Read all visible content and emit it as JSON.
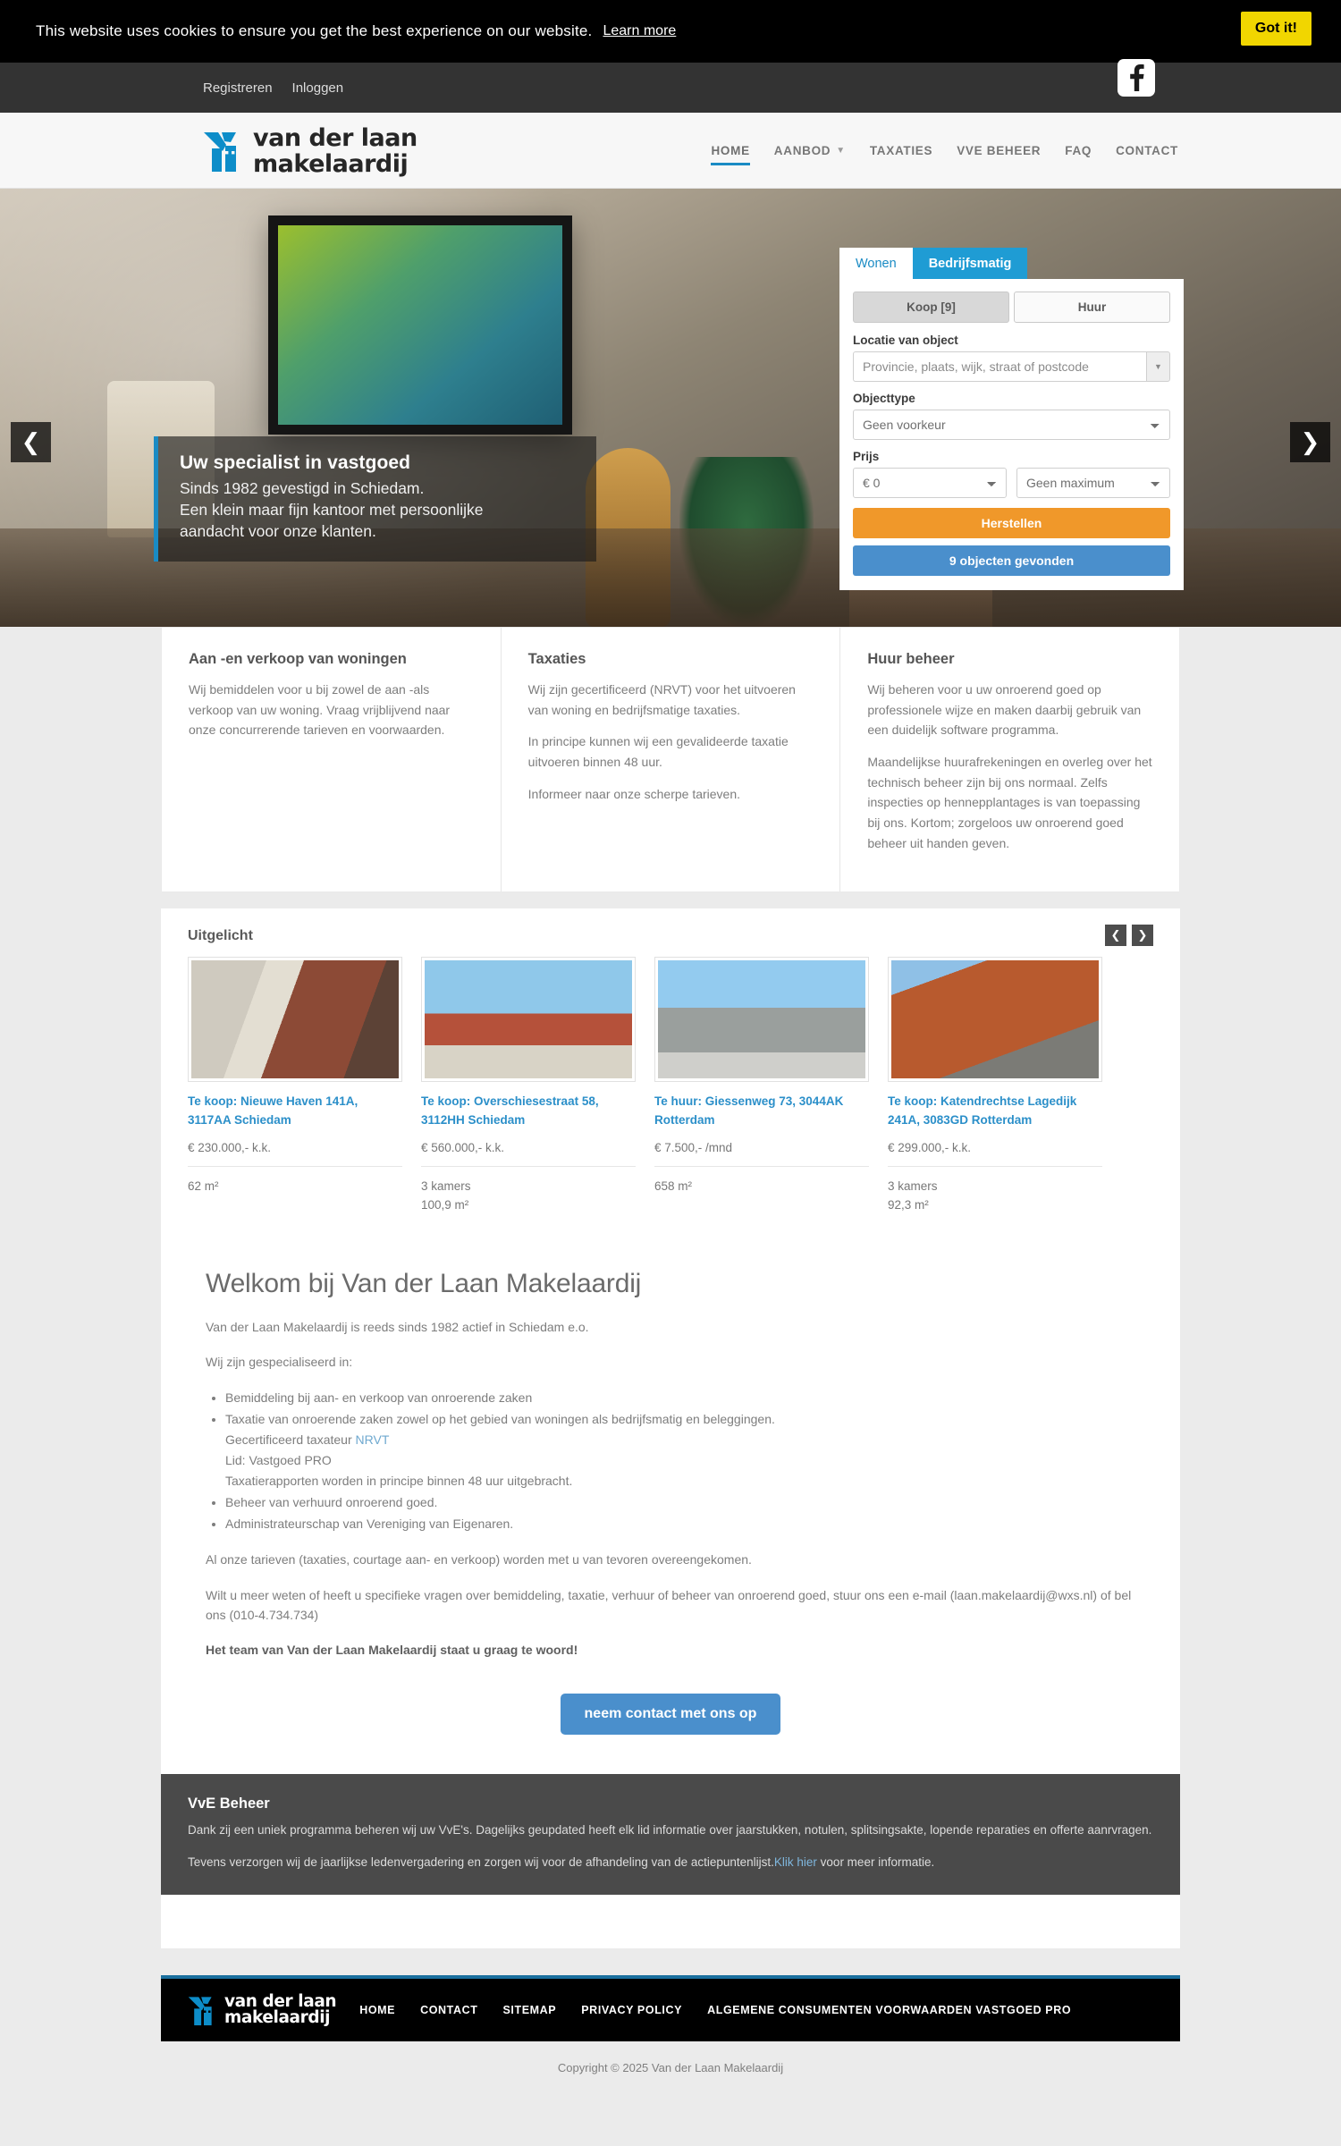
{
  "cookie": {
    "message": "This website uses cookies to ensure you get the best experience on our website.",
    "learn_more": "Learn more",
    "accept": "Got it!"
  },
  "topbar": {
    "register": "Registreren",
    "login": "Inloggen",
    "facebook_icon": "facebook-icon"
  },
  "brand": {
    "line1": "van der laan",
    "line2": "makelaardij",
    "mark_icon": "house-logo-icon"
  },
  "nav": {
    "items": [
      {
        "label": "HOME",
        "active": true,
        "caret": false
      },
      {
        "label": "AANBOD",
        "active": false,
        "caret": true
      },
      {
        "label": "TAXATIES",
        "active": false,
        "caret": false
      },
      {
        "label": "VVE BEHEER",
        "active": false,
        "caret": false
      },
      {
        "label": "FAQ",
        "active": false,
        "caret": false
      },
      {
        "label": "CONTACT",
        "active": false,
        "caret": false
      }
    ]
  },
  "hero": {
    "prev_icon": "chevron-left-icon",
    "next_icon": "chevron-right-icon",
    "title": "Uw specialist in vastgoed",
    "line1": "Sinds 1982 gevestigd in Schiedam.",
    "line2": "Een klein maar fijn kantoor met persoonlijke",
    "line3": "aandacht voor onze klanten."
  },
  "search": {
    "tab_wonen": "Wonen",
    "tab_bedrijfsmatig": "Bedrijfsmatig",
    "koop": "Koop [9]",
    "huur": "Huur",
    "location_label": "Locatie van object",
    "location_placeholder": "Provincie, plaats, wijk, straat of postcode",
    "location_value": "",
    "objecttype_label": "Objecttype",
    "objecttype_value": "Geen voorkeur",
    "price_label": "Prijs",
    "price_min": "€ 0",
    "price_max": "Geen maximum",
    "reset_button": "Herstellen",
    "results_button": "9 objecten gevonden"
  },
  "services": [
    {
      "title": "Aan -en verkoop van woningen",
      "paragraphs": [
        "Wij bemiddelen voor u bij zowel de aan -als verkoop van uw woning. Vraag vrijblijvend naar onze concurrerende tarieven en voorwaarden."
      ]
    },
    {
      "title": "Taxaties",
      "paragraphs": [
        "Wij zijn gecertificeerd (NRVT) voor het uitvoeren van woning en bedrijfsmatige taxaties.",
        "In principe kunnen wij een gevalideerde taxatie uitvoeren binnen 48 uur.",
        "Informeer naar onze scherpe tarieven."
      ]
    },
    {
      "title": "Huur beheer",
      "paragraphs": [
        "Wij beheren voor u uw onroerend goed op professionele wijze en maken daarbij gebruik van een duidelijk software programma.",
        "Maandelijkse huurafrekeningen en overleg over het technisch beheer zijn bij ons normaal. Zelfs inspecties op hennepplantages is van toepassing bij ons. Kortom; zorgeloos uw onroerend goed beheer uit handen geven."
      ]
    }
  ],
  "featured": {
    "heading": "Uitgelicht",
    "prev_icon": "chevron-left-icon",
    "next_icon": "chevron-right-icon",
    "items": [
      {
        "title": "Te koop: Nieuwe Haven 141A, 3117AA Schiedam",
        "price": "€ 230.000,- k.k.",
        "rooms": "",
        "area": "62 m²"
      },
      {
        "title": "Te koop: Overschiesestraat 58, 3112HH Schiedam",
        "price": "€ 560.000,- k.k.",
        "rooms": "3 kamers",
        "area": "100,9 m²"
      },
      {
        "title": "Te huur: Giessenweg 73, 3044AK Rotterdam",
        "price": "€ 7.500,- /mnd",
        "rooms": "",
        "area": "658 m²"
      },
      {
        "title": "Te koop: Katendrechtse Lagedijk 241A, 3083GD Rotterdam",
        "price": "€ 299.000,- k.k.",
        "rooms": "3 kamers",
        "area": "92,3 m²"
      }
    ]
  },
  "welcome": {
    "heading": "Welkom bij Van der Laan Makelaardij",
    "intro": "Van der Laan Makelaardij is reeds sinds 1982 actief in Schiedam e.o.",
    "specialised_label": "Wij zijn gespecialiseerd in:",
    "bullet1": "Bemiddeling bij aan- en verkoop van onroerende zaken",
    "bullet2": "Taxatie van onroerende zaken zowel op het gebied van woningen als bedrijfsmatig en beleggingen.",
    "bullet2_sub1_pre": "Gecertificeerd taxateur ",
    "bullet2_sub1_link": "NRVT",
    "bullet2_sub2": "Lid: Vastgoed PRO",
    "bullet2_sub3": "Taxatierapporten worden in principe binnen 48 uur uitgebracht.",
    "bullet3": "Beheer van verhuurd onroerend goed.",
    "bullet4": "Administrateurschap van Vereniging van Eigenaren.",
    "tariffs": "Al onze tarieven (taxaties, courtage aan- en verkoop) worden met u van tevoren overeengekomen.",
    "contact_text": "Wilt u meer weten of heeft u specifieke vragen over bemiddeling, taxatie, verhuur of beheer van onroerend goed, stuur ons een e-mail (laan.makelaardij@wxs.nl) of bel ons (010-4.734.734)",
    "team_line": "Het team van Van der Laan Makelaardij staat u graag te woord!",
    "contact_button": "neem contact met ons op"
  },
  "vve": {
    "heading": "VvE Beheer",
    "paragraph1": "Dank zij een uniek programma beheren wij uw VvE's. Dagelijks geupdated heeft elk lid informatie over jaarstukken, notulen, splitsingsakte, lopende reparaties en offerte aanrvragen.",
    "paragraph2_pre": "Tevens verzorgen wij de jaarlijkse ledenvergadering en zorgen wij voor de afhandeling van de actiepuntenlijst.",
    "paragraph2_link": "Klik hier",
    "paragraph2_post": " voor meer informatie."
  },
  "footer": {
    "links": [
      "HOME",
      "CONTACT",
      "SITEMAP",
      "PRIVACY POLICY",
      "ALGEMENE CONSUMENTEN VOORWAARDEN VASTGOED PRO"
    ],
    "copyright": "Copyright © 2025 Van der Laan Makelaardij"
  },
  "colors": {
    "brand_blue": "#1a8bc4",
    "accent_orange": "#f0982a",
    "button_blue": "#4a8fcc",
    "cookie_yellow": "#f1d600",
    "dark_panel": "#4a4a4a"
  }
}
